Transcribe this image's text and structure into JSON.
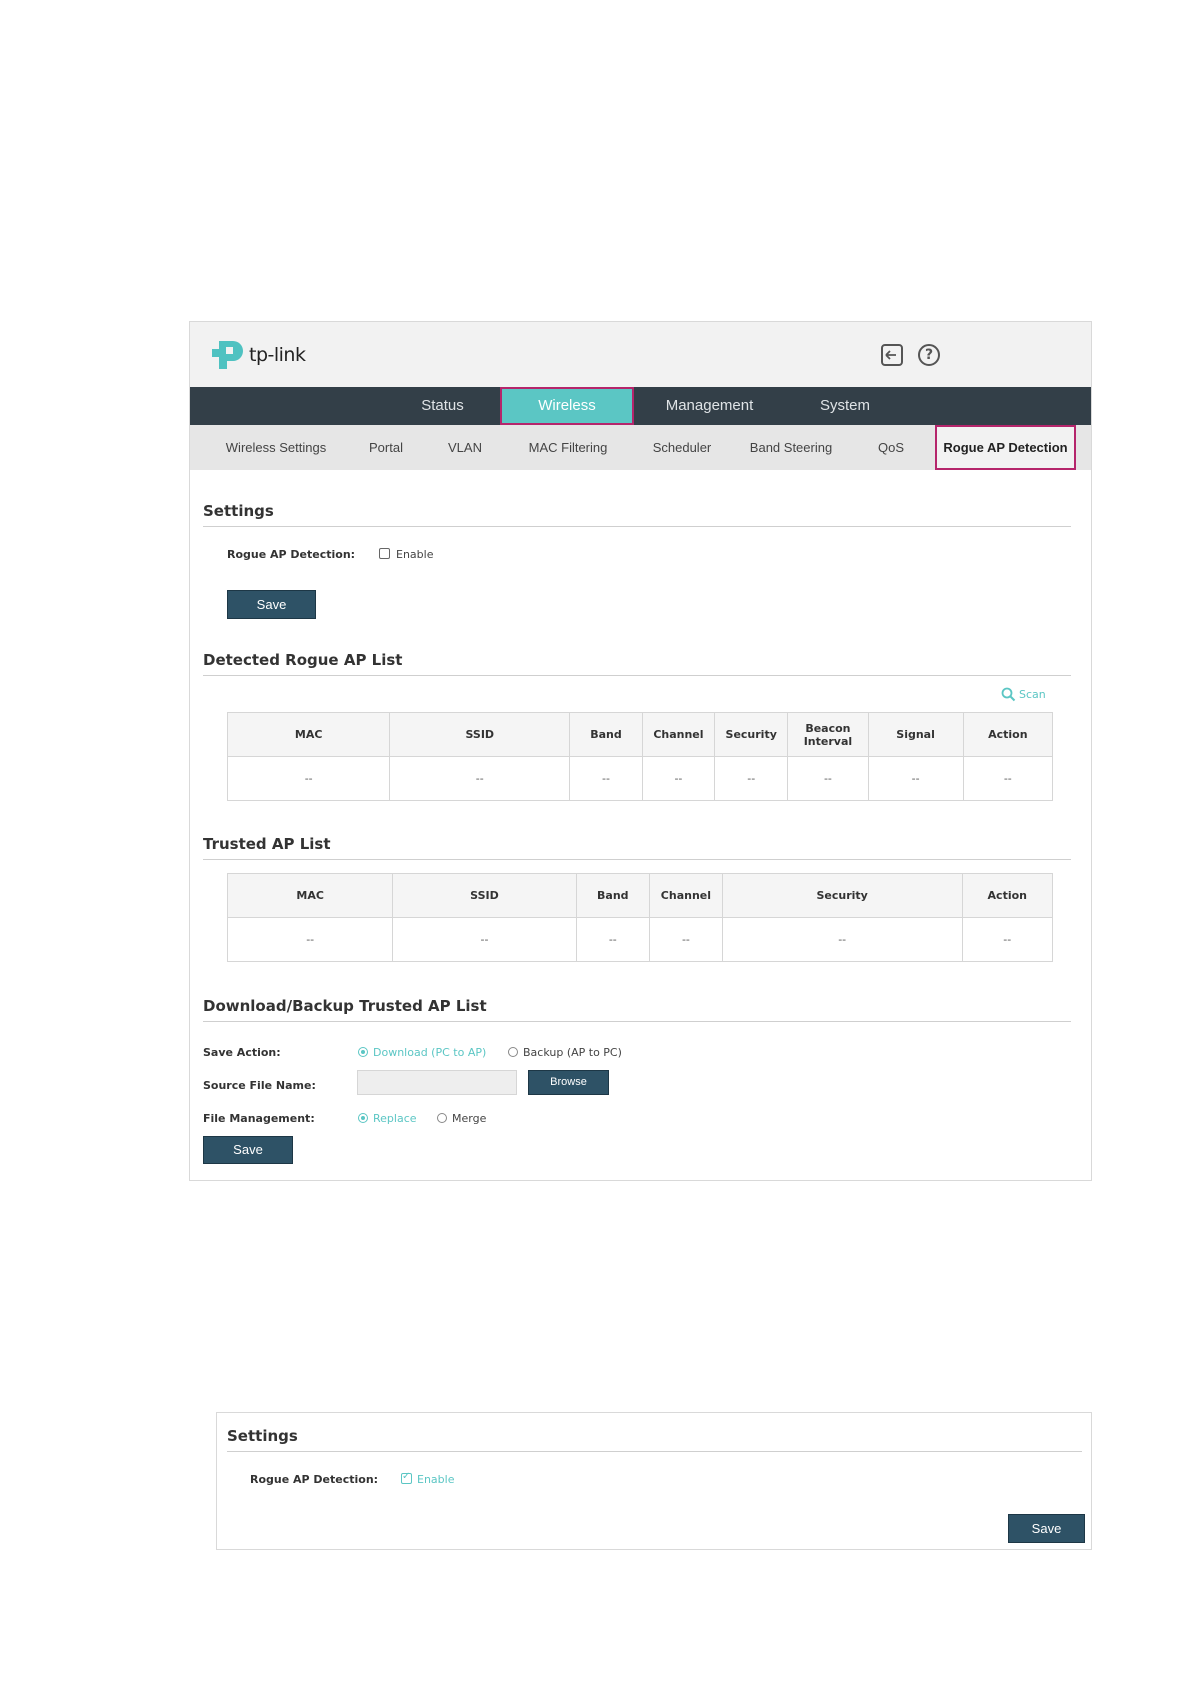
{
  "brand": {
    "logo_text": "tp-link",
    "accent": "#5bc6c4",
    "highlight_border": "#b5256b",
    "nav_bg": "#333f48",
    "button_bg": "#2e5266"
  },
  "top_icons": {
    "logout": "logout-icon",
    "help": "help-icon",
    "help_glyph": "?"
  },
  "main_nav": [
    "Status",
    "Wireless",
    "Management",
    "System"
  ],
  "main_nav_active": "Wireless",
  "sub_nav": [
    "Wireless Settings",
    "Portal",
    "VLAN",
    "MAC Filtering",
    "Scheduler",
    "Band Steering",
    "QoS",
    "Rogue AP Detection"
  ],
  "sub_nav_active": "Rogue AP Detection",
  "settings": {
    "title": "Settings",
    "label": "Rogue AP Detection:",
    "checkbox_label": "Enable",
    "checked": false,
    "save_label": "Save"
  },
  "detected": {
    "title": "Detected Rogue AP List",
    "scan_label": "Scan",
    "columns": [
      "MAC",
      "SSID",
      "Band",
      "Channel",
      "Security",
      "Beacon Interval",
      "Signal",
      "Action"
    ],
    "row": [
      "--",
      "--",
      "--",
      "--",
      "--",
      "--",
      "--",
      "--"
    ]
  },
  "trusted": {
    "title": "Trusted AP List",
    "columns": [
      "MAC",
      "SSID",
      "Band",
      "Channel",
      "Security",
      "Action"
    ],
    "row": [
      "--",
      "--",
      "--",
      "--",
      "--",
      "--"
    ]
  },
  "download": {
    "title": "Download/Backup Trusted AP List",
    "save_action_label": "Save Action:",
    "option_download": "Download (PC to AP)",
    "option_backup": "Backup (AP to PC)",
    "selected_action": "Download (PC to AP)",
    "source_label": "Source File Name:",
    "source_value": "",
    "browse_label": "Browse",
    "file_mgmt_label": "File Management:",
    "option_replace": "Replace",
    "option_merge": "Merge",
    "selected_mgmt": "Replace",
    "save_label": "Save"
  },
  "settings_enabled": {
    "title": "Settings",
    "label": "Rogue AP Detection:",
    "checkbox_label": "Enable",
    "checked": true,
    "save_label": "Save"
  }
}
